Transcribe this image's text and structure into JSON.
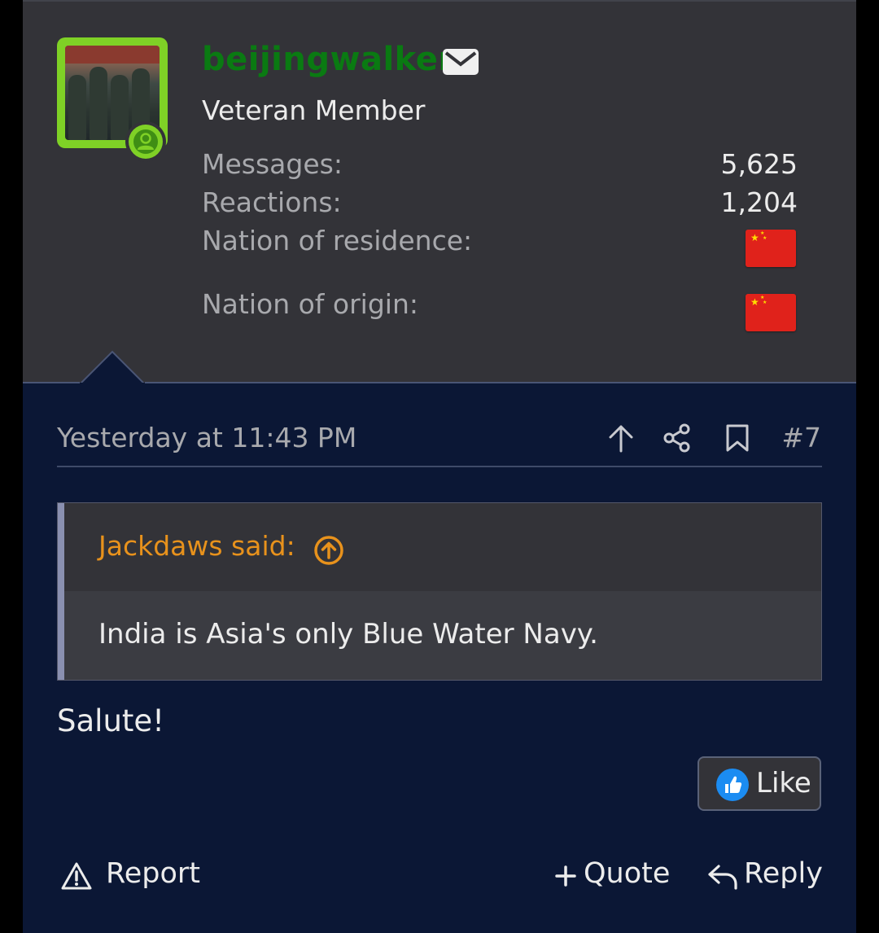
{
  "user": {
    "username": "beijingwalker",
    "title": "Veteran Member",
    "stats": {
      "messages_label": "Messages:",
      "messages_value": "5,625",
      "reactions_label": "Reactions:",
      "reactions_value": "1,204",
      "residence_label": "Nation of residence:",
      "origin_label": "Nation of origin:"
    }
  },
  "post": {
    "date": "Yesterday at 11:43 PM",
    "number": "#7",
    "quote": {
      "author": "Jackdaws said:",
      "text": "India is Asia's only Blue Water Navy."
    },
    "body": "Salute!",
    "like_label": "Like"
  },
  "footer": {
    "report_label": "Report",
    "quote_label": "Quote",
    "reply_label": "Reply"
  },
  "colors": {
    "username": "#0a7a12",
    "avatar_border": "#7fd126",
    "quote_author": "#e8921c",
    "panel_bg": "#0b1735",
    "user_block_bg": "#333338"
  }
}
